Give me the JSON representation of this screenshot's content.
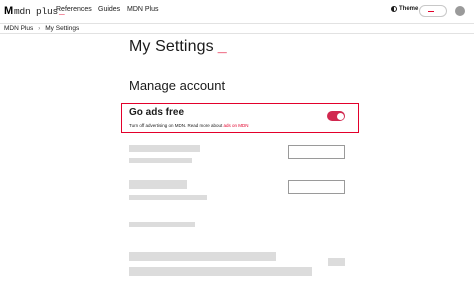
{
  "header": {
    "logo_text": "mdn plus",
    "logo_mark": "M",
    "logo_underscore": "_",
    "nav_items": [
      "References",
      "Guides",
      "MDN Plus"
    ],
    "theme_label": "Theme",
    "theme_icon": "half-circle-icon",
    "search_icon": "search-cursor-icon",
    "avatar_icon": "user-avatar-icon"
  },
  "breadcrumb": {
    "items": [
      "MDN Plus",
      "My Settings"
    ],
    "separator": "›"
  },
  "main": {
    "title": "My Settings",
    "title_underscore": "_",
    "section_title": "Manage account",
    "ads_card": {
      "title": "Go ads free",
      "description": "Turn off advertising on MDN. Read more about ",
      "link_text": "ads on MDN",
      "toggle_on": true
    }
  },
  "colors": {
    "accent": "#e3002b",
    "toggle": "#d1284f",
    "skeleton": "#dcdcdc"
  }
}
